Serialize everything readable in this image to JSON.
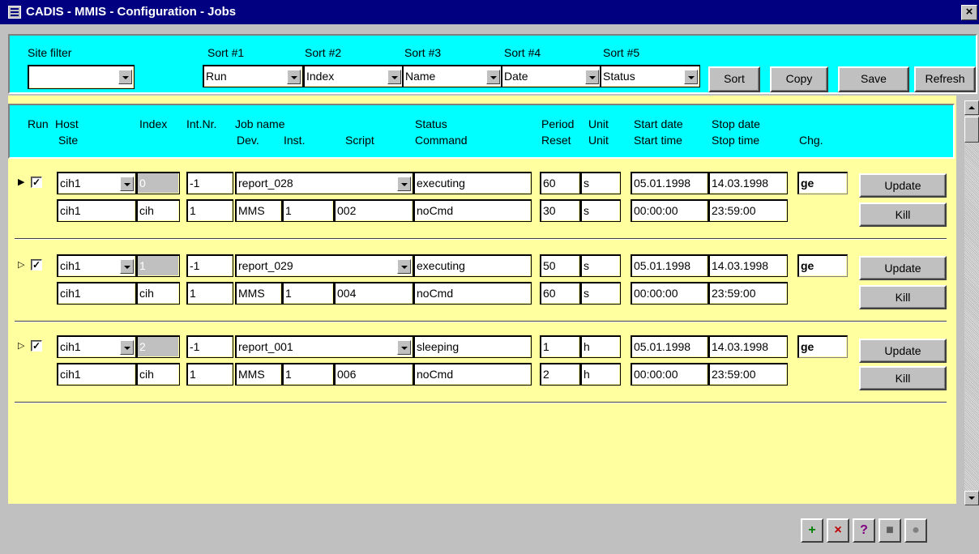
{
  "window": {
    "title": "CADIS - MMIS - Configuration - Jobs",
    "close_label": "×"
  },
  "filters": {
    "site_filter_label": "Site filter",
    "site_filter_value": "",
    "sorts": [
      {
        "label": "Sort #1",
        "value": "Run"
      },
      {
        "label": "Sort #2",
        "value": "Index"
      },
      {
        "label": "Sort #3",
        "value": "Name"
      },
      {
        "label": "Sort #4",
        "value": "Date"
      },
      {
        "label": "Sort #5",
        "value": "Status"
      }
    ],
    "buttons": {
      "sort": "Sort",
      "copy": "Copy",
      "save": "Save",
      "refresh": "Refresh"
    }
  },
  "columns": {
    "run": "Run",
    "host": "Host",
    "site": "Site",
    "index": "Index",
    "int_nr": "Int.Nr.",
    "job_name": "Job name",
    "dev": "Dev.",
    "inst": "Inst.",
    "script": "Script",
    "status": "Status",
    "command": "Command",
    "period": "Period",
    "reset": "Reset",
    "unit1": "Unit",
    "unit2": "Unit",
    "start_date": "Start date",
    "start_time": "Start time",
    "stop_date": "Stop date",
    "stop_time": "Stop time",
    "chg": "Chg."
  },
  "jobs": [
    {
      "pointer": "▶",
      "checked": "✓",
      "host": "cih1",
      "index": "0",
      "int_nr": "-1",
      "job_name": "report_028",
      "status": "executing",
      "period": "60",
      "period_unit": "s",
      "start_date": "05.01.1998",
      "stop_date": "14.03.1998",
      "chg": "ge",
      "site": "cih1",
      "site2": "cih",
      "int_nr2": "1",
      "dev": "MMS",
      "inst": "1",
      "script": "002",
      "command": "noCmd",
      "reset": "30",
      "reset_unit": "s",
      "start_time": "00:00:00",
      "stop_time": "23:59:00",
      "update_label": "Update",
      "kill_label": "Kill"
    },
    {
      "pointer": "▷",
      "checked": "✓",
      "host": "cih1",
      "index": "1",
      "int_nr": "-1",
      "job_name": "report_029",
      "status": "executing",
      "period": "50",
      "period_unit": "s",
      "start_date": "05.01.1998",
      "stop_date": "14.03.1998",
      "chg": "ge",
      "site": "cih1",
      "site2": "cih",
      "int_nr2": "1",
      "dev": "MMS",
      "inst": "1",
      "script": "004",
      "command": "noCmd",
      "reset": "60",
      "reset_unit": "s",
      "start_time": "00:00:00",
      "stop_time": "23:59:00",
      "update_label": "Update",
      "kill_label": "Kill"
    },
    {
      "pointer": "▷",
      "checked": "✓",
      "host": "cih1",
      "index": "2",
      "int_nr": "-1",
      "job_name": "report_001",
      "status": "sleeping",
      "period": "1",
      "period_unit": "h",
      "start_date": "05.01.1998",
      "stop_date": "14.03.1998",
      "chg": "ge",
      "site": "cih1",
      "site2": "cih",
      "int_nr2": "1",
      "dev": "MMS",
      "inst": "1",
      "script": "006",
      "command": "noCmd",
      "reset": "2",
      "reset_unit": "h",
      "start_time": "00:00:00",
      "stop_time": "23:59:00",
      "update_label": "Update",
      "kill_label": "Kill"
    }
  ],
  "toolbar_icons": [
    "add-job-icon",
    "delete-job-icon",
    "query-icon",
    "stop-icon",
    "disabled-icon"
  ],
  "colors": {
    "title_bar": "#000080",
    "header_panel": "#00ffff",
    "content_bg": "#ffffa0",
    "window_bg": "#c0c0c0"
  }
}
